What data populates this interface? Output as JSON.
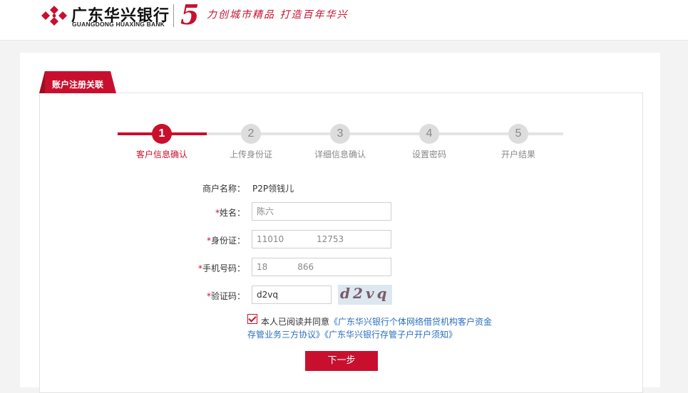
{
  "header": {
    "bank_name_cn": "广东华兴银行",
    "bank_name_en": "GUANGDONG HUAXING BANK",
    "anniversary": "5",
    "slogan": "力创城市精品 打造百年华兴"
  },
  "tab": {
    "label": "账户注册关联"
  },
  "steps": [
    {
      "num": "1",
      "label": "客户信息确认"
    },
    {
      "num": "2",
      "label": "上传身份证"
    },
    {
      "num": "3",
      "label": "详细信息确认"
    },
    {
      "num": "4",
      "label": "设置密码"
    },
    {
      "num": "5",
      "label": "开户结果"
    }
  ],
  "form": {
    "merchant_label": "商户名称：",
    "merchant_value": "P2P领钱儿",
    "required_mark": "*",
    "name_label": "姓名：",
    "name_value": "陈六",
    "id_label": "身份证：",
    "id_value": "11010            12753",
    "phone_label": "手机号码：",
    "phone_value": "18           866",
    "captcha_label": "验证码：",
    "captcha_value": "d2vq",
    "captcha_image_text": "d2vq"
  },
  "agreement": {
    "prefix": "本人已阅读并同意",
    "link1_a": "《广东华兴银行个体网络借贷机构客户资金",
    "link1_b": "存管业务三方协议》",
    "link2": "《广东华兴银行存管子户开户须知》"
  },
  "next_button": "下一步",
  "colors": {
    "brand_red": "#c8102e",
    "link_blue": "#2a6fbf"
  }
}
